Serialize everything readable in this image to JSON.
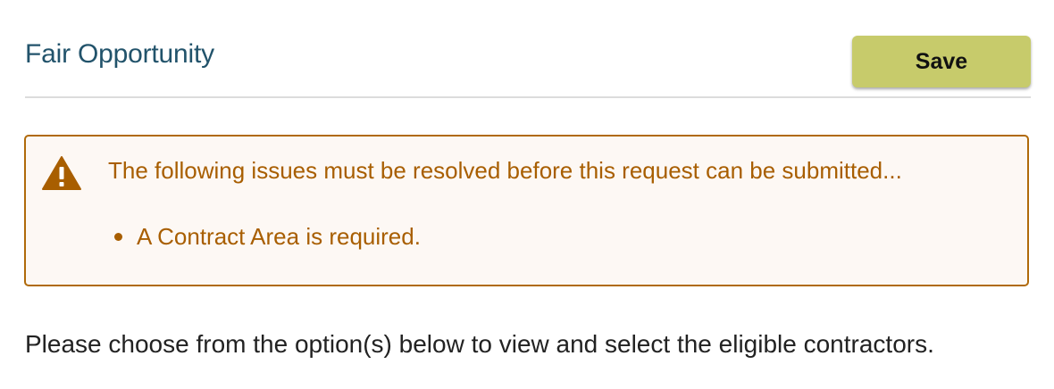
{
  "header": {
    "title": "Fair Opportunity",
    "save_label": "Save"
  },
  "alert": {
    "icon": "warning-icon",
    "message": "The following issues must be resolved before this request can be submitted...",
    "issues": [
      "A Contract Area is required."
    ],
    "colors": {
      "text": "#a85e00",
      "border": "#b06a0a",
      "background": "#fdf8f4"
    }
  },
  "instructions": "Please choose from the option(s) below to view and select the eligible contractors.",
  "colors": {
    "title": "#22536b",
    "save_button": "#c7cb6b"
  }
}
